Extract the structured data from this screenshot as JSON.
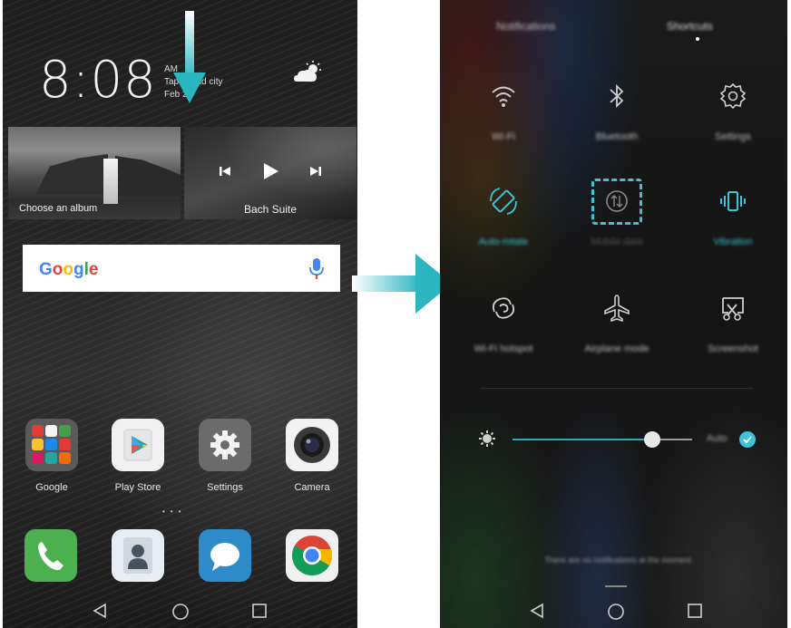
{
  "left_phone": {
    "clock": {
      "time": "8:08",
      "info_line1": "AM",
      "info_line2": "Tap to add city",
      "info_line3": "Feb 24"
    },
    "weather_icon": "cloud-sun-icon",
    "album_card": {
      "label": "Choose an album"
    },
    "music_card": {
      "title": "Bach Suite"
    },
    "google_bar": {
      "logo": "Google",
      "mic_icon": "mic-icon"
    },
    "apps": [
      {
        "label": "Google",
        "icon": "google-folder-icon"
      },
      {
        "label": "Play Store",
        "icon": "play-store-icon"
      },
      {
        "label": "Settings",
        "icon": "settings-gear-icon"
      },
      {
        "label": "Camera",
        "icon": "camera-icon"
      }
    ],
    "page_dots": "•••",
    "dock": [
      "phone-icon",
      "contacts-icon",
      "messaging-icon",
      "chrome-icon"
    ],
    "nav": {
      "back": "◁",
      "home": "○",
      "recent": "□"
    }
  },
  "right_phone": {
    "tabs": [
      "Notifications",
      "Shortcuts"
    ],
    "tiles": [
      {
        "label": "Wi-Fi",
        "icon": "wifi-icon",
        "active": false
      },
      {
        "label": "Bluetooth",
        "icon": "bluetooth-icon",
        "active": false
      },
      {
        "label": "Settings",
        "icon": "settings-icon",
        "active": false
      },
      {
        "label": "Auto-rotate",
        "icon": "auto-rotate-icon",
        "active": true
      },
      {
        "label": "Mobile data",
        "icon": "mobile-data-icon",
        "active": false
      },
      {
        "label": "Vibration",
        "icon": "vibration-icon",
        "active": true
      },
      {
        "label": "Wi-Fi hotspot",
        "icon": "hotspot-icon",
        "active": false
      },
      {
        "label": "Airplane mode",
        "icon": "airplane-icon",
        "active": false
      },
      {
        "label": "Screenshot",
        "icon": "screenshot-icon",
        "active": false
      }
    ],
    "brightness": {
      "icon": "brightness-icon",
      "auto_label": "Auto",
      "level": 0.78
    },
    "notification_text": "There are no notifications at the moment",
    "nav": {
      "back": "◁",
      "home": "○",
      "recent": "□"
    },
    "colors": {
      "accent": "#3dc4d4"
    }
  }
}
